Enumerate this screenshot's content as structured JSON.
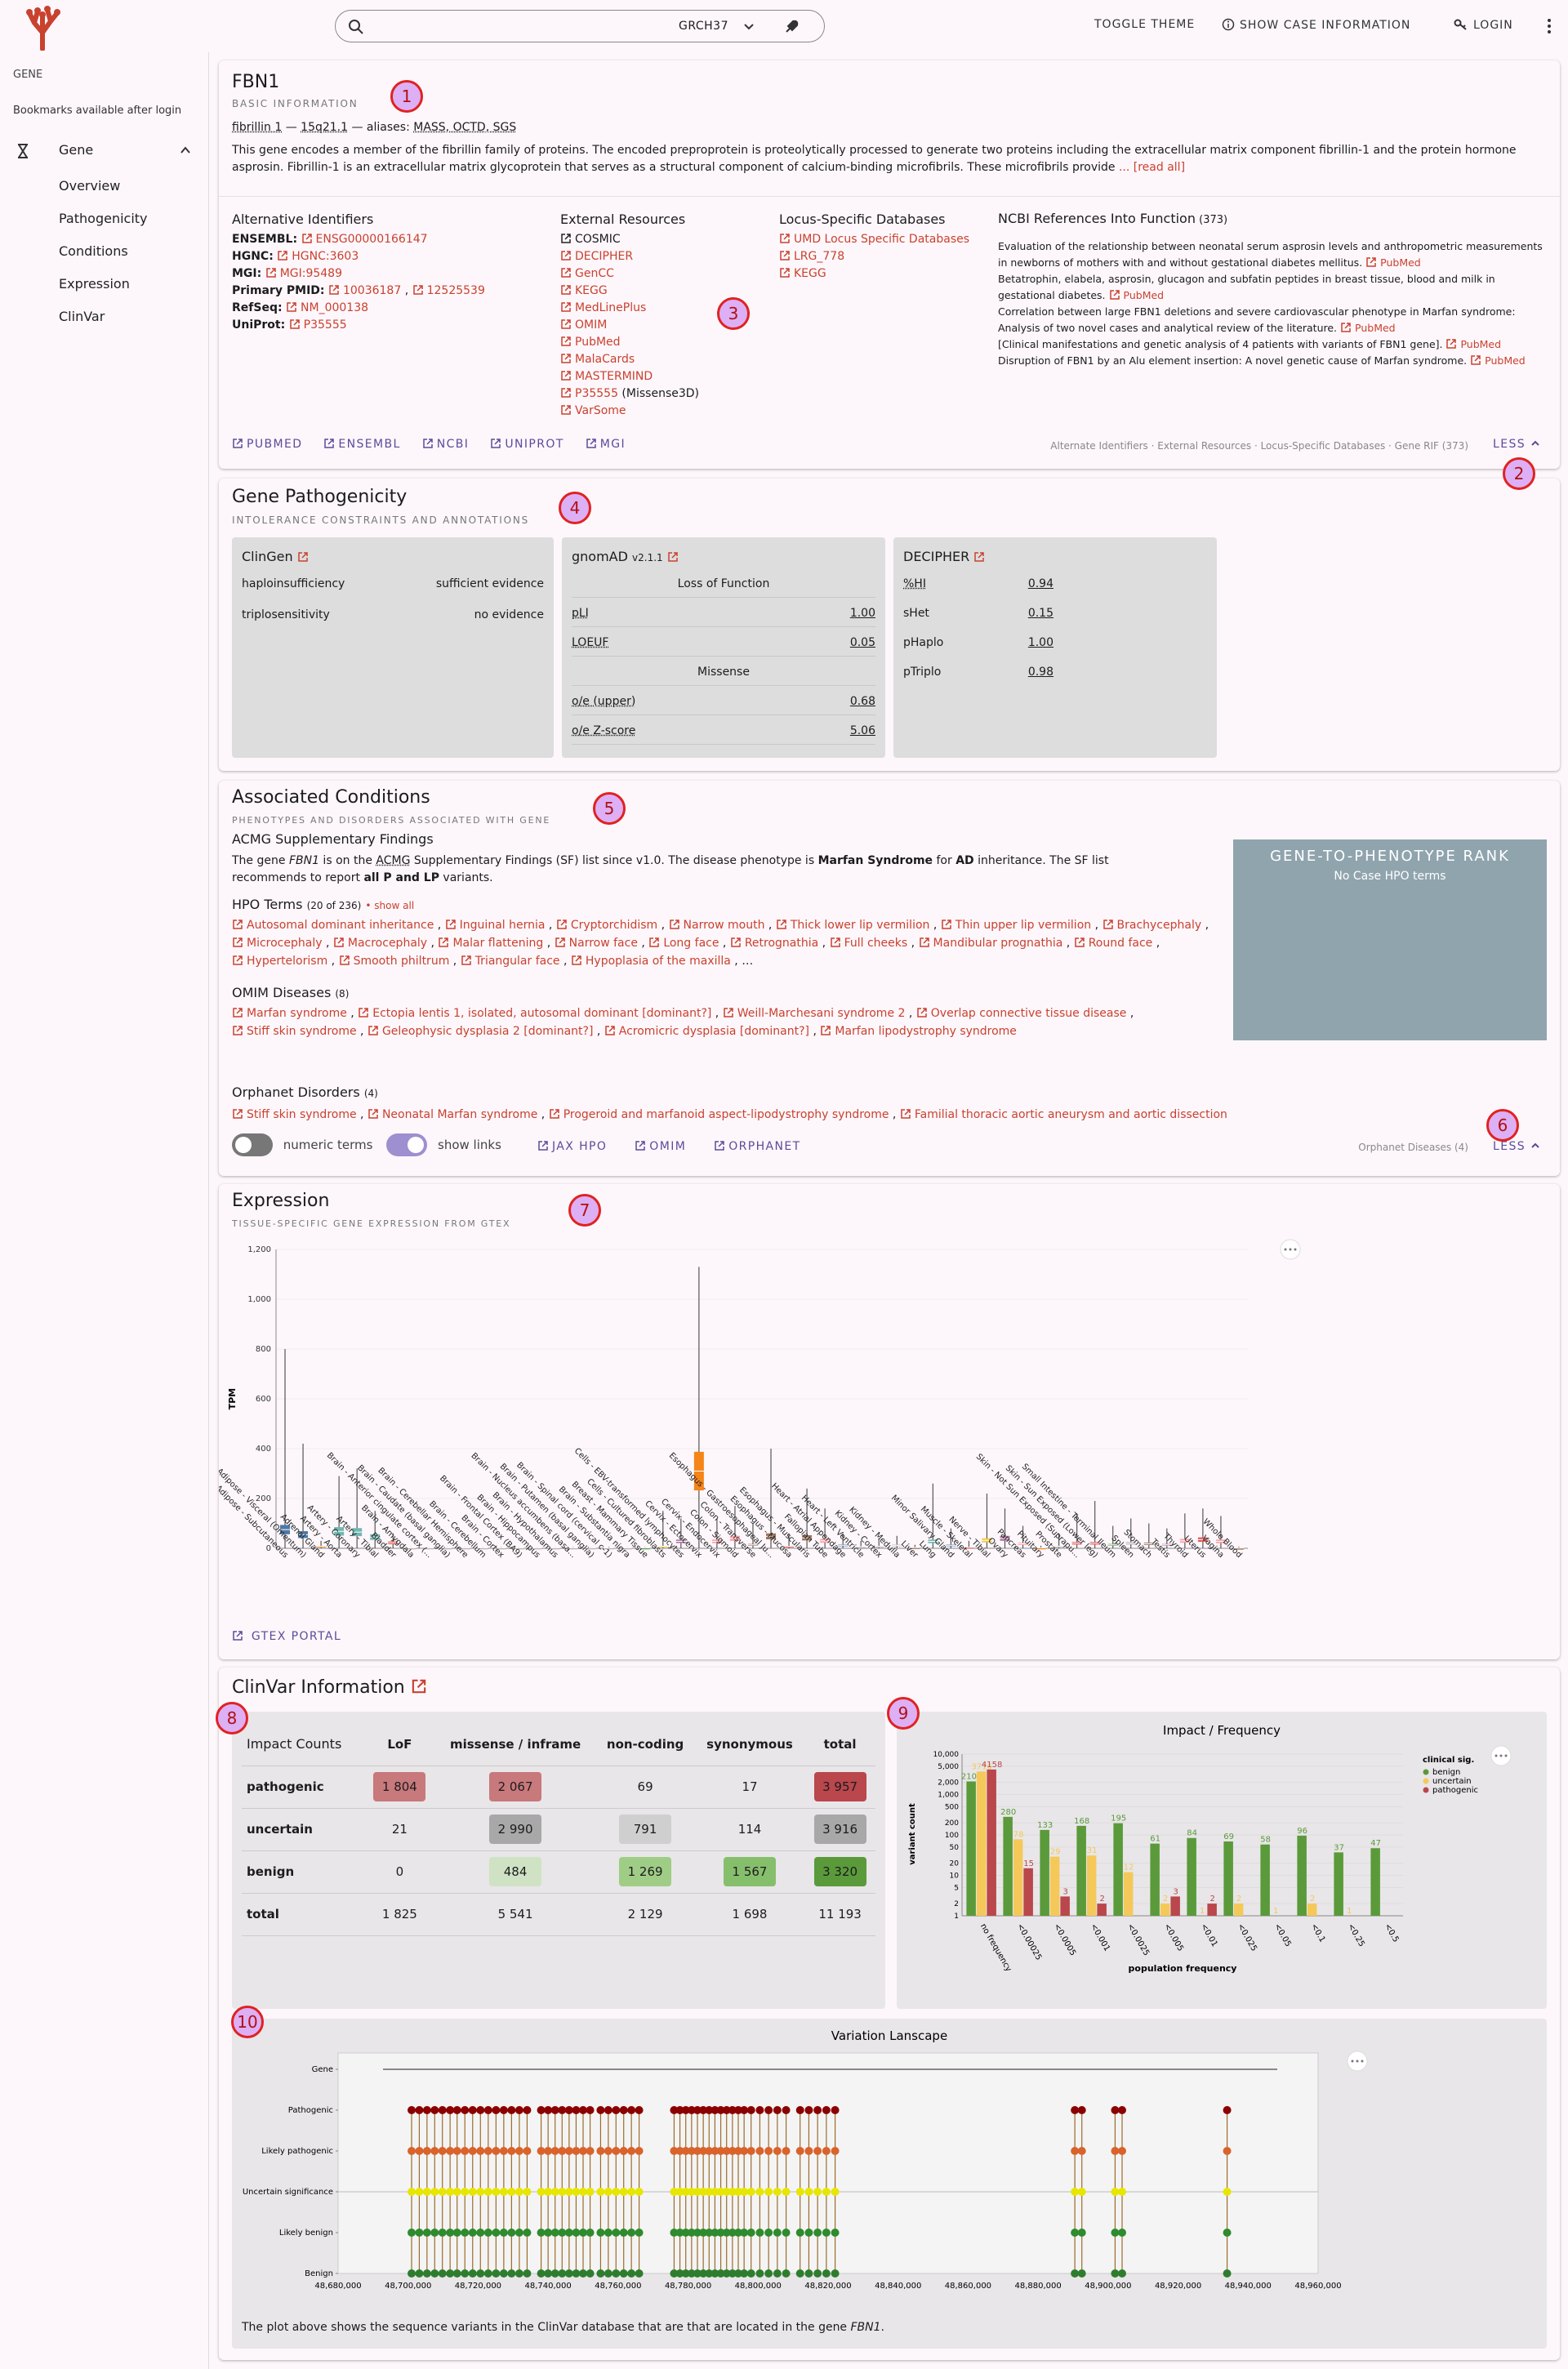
{
  "header": {
    "genome": "GRCH37",
    "toggle_theme": "TOGGLE THEME",
    "show_case": "SHOW CASE INFORMATION",
    "login": "LOGIN"
  },
  "sidebar": {
    "section": "GENE",
    "bookmarks": "Bookmarks available after login",
    "gene": "Gene",
    "items": [
      "Overview",
      "Pathogenicity",
      "Conditions",
      "Expression",
      "ClinVar"
    ]
  },
  "basic": {
    "symbol": "FBN1",
    "subtitle": "BASIC INFORMATION",
    "name": "fibrillin 1",
    "location": "15q21.1",
    "aliases_prefix": " — aliases: ",
    "aliases": "MASS, OCTD, SGS",
    "summary": "This gene encodes a member of the fibrillin family of proteins. The encoded preproprotein is proteolytically processed to generate two proteins including the extracellular matrix component fibrillin-1 and the protein hormone asprosin. Fibrillin-1 is an extracellular matrix glycoprotein that serves as a structural component of calcium-binding microfibrils. These microfibrils provide",
    "read_all": "... [read all]",
    "alt_title": "Alternative Identifiers",
    "alt": [
      {
        "k": "ENSEMBL:",
        "v": "ENSG00000166147"
      },
      {
        "k": "HGNC:",
        "v": "HGNC:3603"
      },
      {
        "k": "MGI:",
        "v": "MGI:95489"
      },
      {
        "k": "RefSeq:",
        "v": "NM_000138"
      },
      {
        "k": "UniProt:",
        "v": "P35555"
      }
    ],
    "pmid_label": "Primary PMID:",
    "pmid1": "10036187",
    "pmid2": "12525539",
    "ext_title": "External Resources",
    "ext_cosmic": "COSMIC",
    "ext": [
      "DECIPHER",
      "GenCC",
      "KEGG",
      "MedLinePlus",
      "OMIM",
      "PubMed",
      "MalaCards",
      "MASTERMIND",
      "P35555"
    ],
    "ext_m3d": " (Missense3D)",
    "ext_last": "VarSome",
    "locus_title": "Locus-Specific Databases",
    "locus": [
      "UMD Locus Specific Databases",
      "LRG_778",
      "KEGG"
    ],
    "rif_title": "NCBI References Into Function",
    "rif_count": " (373)",
    "rif": [
      {
        "t": "Evaluation of the relationship between neonatal serum asprosin levels and anthropometric measurements in newborns of mothers with and without gestational diabetes mellitus.",
        "l": "PubMed"
      },
      {
        "t": "Betatrophin, elabela, asprosin, glucagon and subfatin peptides in breast tissue, blood and milk in gestational diabetes.",
        "l": "PubMed"
      },
      {
        "t": "Correlation between large FBN1 deletions and severe cardiovascular phenotype in Marfan syndrome: Analysis of two novel cases and analytical review of the literature.",
        "l": "PubMed"
      },
      {
        "t": "[Clinical manifestations and genetic analysis of 4 patients with variants of FBN1 gene].",
        "l": "PubMed"
      },
      {
        "t": "Disruption of FBN1 by an Alu element insertion: A novel genetic cause of Marfan syndrome.",
        "l": "PubMed"
      }
    ],
    "links": [
      "PUBMED",
      "ENSEMBL",
      "NCBI",
      "UNIPROT",
      "MGI"
    ],
    "footnote": "Alternate Identifiers · External Resources · Locus-Specific Databases · Gene RIF (373)",
    "less": "LESS"
  },
  "path": {
    "title": "Gene Pathogenicity",
    "subtitle": "INTOLERANCE CONSTRAINTS AND ANNOTATIONS",
    "clingen": {
      "title": "ClinGen",
      "rows": [
        {
          "k": "haploinsufficiency",
          "v": "sufficient evidence"
        },
        {
          "k": "triplosensitivity",
          "v": "no evidence"
        }
      ]
    },
    "gnomad": {
      "title": "gnomAD",
      "ver": "v2.1.1",
      "lof": "Loss of Function",
      "rows1": [
        {
          "k": "pLI",
          "v": "1.00"
        },
        {
          "k": "LOEUF",
          "v": "0.05"
        }
      ],
      "mis": "Missense",
      "rows2": [
        {
          "k": "o/e (upper)",
          "v": "0.68"
        },
        {
          "k": "o/e Z-score",
          "v": "5.06"
        }
      ]
    },
    "decipher": {
      "title": "DECIPHER",
      "rows": [
        {
          "k": "%HI",
          "v": "0.94"
        },
        {
          "k": "sHet",
          "v": "0.15"
        },
        {
          "k": "pHaplo",
          "v": "1.00"
        },
        {
          "k": "pTriplo",
          "v": "0.98"
        }
      ]
    }
  },
  "cond": {
    "title": "Associated Conditions",
    "subtitle": "PHENOTYPES AND DISORDERS ASSOCIATED WITH GENE",
    "acmg_title": "ACMG Supplementary Findings",
    "acmg_1": "The gene ",
    "acmg_gene": "FBN1",
    "acmg_2": " is on the ",
    "acmg_abbr": "ACMG",
    "acmg_3": " Supplementary Findings (SF) list since v1.0. The disease phenotype is ",
    "acmg_dis": "Marfan Syndrome",
    "acmg_4": " for ",
    "acmg_inh": "AD",
    "acmg_5": " inheritance. The SF list recommends to report ",
    "acmg_rep": "all P and LP",
    "acmg_6": " variants.",
    "hpo_title": "HPO Terms",
    "hpo_count": "(20 of 236)",
    "show_all": "• show all",
    "hpo": [
      "Autosomal dominant inheritance",
      "Inguinal hernia",
      "Cryptorchidism",
      "Narrow mouth",
      "Thick lower lip vermilion",
      "Thin upper lip vermilion",
      "Brachycephaly",
      "Microcephaly",
      "Macrocephaly",
      "Malar flattening",
      "Narrow face",
      "Long face",
      "Retrognathia",
      "Full cheeks",
      "Mandibular prognathia",
      "Round face",
      "Hypertelorism",
      "Smooth philtrum",
      "Triangular face",
      "Hypoplasia of the maxilla"
    ],
    "omim_title": "OMIM Diseases",
    "omim_count": "(8)",
    "omim": [
      "Marfan syndrome",
      "Ectopia lentis 1, isolated, autosomal dominant [dominant?]",
      "Weill-Marchesani syndrome 2",
      "Overlap connective tissue disease",
      "Stiff skin syndrome",
      "Geleophysic dysplasia 2 [dominant?]",
      "Acromicric dysplasia [dominant?]",
      "Marfan lipodystrophy syndrome"
    ],
    "orpha_title": "Orphanet Disorders",
    "orpha_count": "(4)",
    "orpha": [
      "Stiff skin syndrome",
      "Neonatal Marfan syndrome",
      "Progeroid and marfanoid aspect-lipodystrophy syndrome",
      "Familial thoracic aortic aneurysm and aortic dissection"
    ],
    "numeric": "numeric terms",
    "showlinks": "show links",
    "links": [
      "JAX HPO",
      "OMIM",
      "ORPHANET"
    ],
    "footnote": "Orphanet Diseases (4)",
    "less": "LESS",
    "g2p_title": "GENE-TO-PHENOTYPE RANK",
    "g2p_text": "No Case HPO terms"
  },
  "expr": {
    "title": "Expression",
    "subtitle": "TISSUE-SPECIFIC GENE EXPRESSION FROM GTEX",
    "ylabel": "TPM",
    "gtex": "GTEX PORTAL"
  },
  "clinvar": {
    "title": "ClinVar Information",
    "table": {
      "corner": "Impact Counts",
      "headers": [
        "LoF",
        "missense / inframe",
        "non-coding",
        "synonymous",
        "total"
      ],
      "rows": [
        {
          "label": "pathogenic",
          "cells": [
            "1 804",
            "2 067",
            "69",
            "17",
            "3 957"
          ]
        },
        {
          "label": "uncertain",
          "cells": [
            "21",
            "2 990",
            "791",
            "114",
            "3 916"
          ]
        },
        {
          "label": "benign",
          "cells": [
            "0",
            "484",
            "1 269",
            "1 567",
            "3 320"
          ]
        },
        {
          "label": "total",
          "cells": [
            "1 825",
            "5 541",
            "2 129",
            "1 698",
            "11 193"
          ]
        }
      ]
    },
    "note": "The plot above shows the sequence variants in the ClinVar database that are that are located in the gene ",
    "note_gene": "FBN1",
    "note_end": "."
  },
  "badges": [
    "1",
    "2",
    "3",
    "4",
    "5",
    "6",
    "7",
    "8",
    "9",
    "10"
  ],
  "colors": {
    "accent": "#c9412f",
    "links": "#5b4b9a",
    "pathogenic": "#b9474b",
    "uncertain": "#f5c85a",
    "benign": "#5a9a3a"
  },
  "chart_data": [
    {
      "type": "box",
      "title": "",
      "ylabel": "TPM",
      "ylim": [
        0,
        1200
      ],
      "yticks": [
        0,
        200,
        400,
        600,
        800,
        1000,
        1200
      ],
      "categories": [
        "Adipose - Subcutaneous",
        "Adipose - Visceral (Omentum)",
        "Adrenal Gland",
        "Artery - Aorta",
        "Artery - Coronary",
        "Artery - Tibial",
        "Bladder",
        "Brain - Amygdala",
        "Brain - Anterior cingulate cortex (...",
        "Brain - Caudate (basal ganglia)",
        "Brain - Cerebellar Hemisphere",
        "Brain - Cerebellum",
        "Brain - Cortex",
        "Brain - Frontal Cortex (BA9)",
        "Brain - Hippocampus",
        "Brain - Hypothalamus",
        "Brain - Nucleus accumbens (basa...",
        "Brain - Putamen (basal ganglia)",
        "Brain - Spinal cord (cervical c-1)",
        "Brain - Substantia nigra",
        "Breast - Mammary Tissue",
        "Cells - Cultured fibroblasts",
        "Cells - EBV-transformed lymphocytes",
        "Cervix - Ectocervix",
        "Cervix - Endocervix",
        "Colon - Sigmoid",
        "Colon - Transverse",
        "Esophagus - Gastroesophageal Ju...",
        "Esophagus - Mucosa",
        "Esophagus - Muscularis",
        "Fallopian Tube",
        "Heart - Atrial Appendage",
        "Heart - Left Ventricle",
        "Kidney - Cortex",
        "Kidney - Medulla",
        "Liver",
        "Lung",
        "Minor Salivary Gland",
        "Muscle - Skeletal",
        "Nerve - Tibial",
        "Ovary",
        "Pancreas",
        "Pituitary",
        "Prostate",
        "Skin - Not Sun Exposed (Suprapu...",
        "Skin - Sun Exposed (Lower leg)",
        "Small Intestine - Terminal Ileum",
        "Spleen",
        "Stomach",
        "Testis",
        "Thyroid",
        "Uterus",
        "Vagina",
        "Whole Blood"
      ],
      "medians": [
        75,
        55,
        8,
        68,
        65,
        45,
        22,
        2,
        2,
        2,
        2,
        2,
        2,
        2,
        2,
        2,
        2,
        2,
        2,
        2,
        2,
        8,
        28,
        310,
        28,
        40,
        14,
        48,
        8,
        42,
        30,
        12,
        6,
        8,
        12,
        3,
        28,
        12,
        4,
        32,
        40,
        18,
        2,
        8,
        20,
        20,
        14,
        20,
        18,
        14,
        30,
        35,
        28,
        1
      ],
      "maxes": [
        800,
        420,
        30,
        290,
        320,
        150,
        60,
        4,
        4,
        4,
        4,
        4,
        5,
        4,
        4,
        4,
        5,
        4,
        6,
        4,
        5,
        150,
        120,
        1130,
        120,
        170,
        100,
        400,
        60,
        240,
        160,
        60,
        30,
        40,
        50,
        14,
        260,
        80,
        30,
        220,
        160,
        90,
        10,
        60,
        140,
        190,
        90,
        120,
        100,
        80,
        140,
        160,
        130,
        6
      ]
    },
    {
      "type": "bar",
      "title": "Impact / Frequency",
      "xlabel": "population frequency",
      "ylabel": "variant count",
      "yscale": "log",
      "ylim": [
        1,
        10000
      ],
      "yticks": [
        "1",
        "2",
        "5",
        "10",
        "20",
        "50",
        "100",
        "200",
        "500",
        "1,000",
        "2,000",
        "5,000",
        "10,000"
      ],
      "categories": [
        "no frequency",
        "<0.00025",
        "<0.0005",
        "<0.001",
        "<0.0025",
        "<0.005",
        "<0.01",
        "<0.025",
        "<0.05",
        "<0.1",
        "<0.25",
        "<0.5"
      ],
      "legend_title": "clinical sig.",
      "series": [
        {
          "name": "benign",
          "values": [
            2106,
            280,
            133,
            168,
            195,
            61,
            84,
            69,
            58,
            96,
            37,
            47
          ]
        },
        {
          "name": "uncertain",
          "values": [
            3716,
            78,
            29,
            31,
            12,
            2,
            1,
            2,
            1,
            2,
            1,
            null
          ]
        },
        {
          "name": "pathogenic",
          "values": [
            4158,
            15,
            3,
            2,
            null,
            3,
            2,
            null,
            null,
            null,
            null,
            null
          ]
        }
      ]
    },
    {
      "type": "scatter",
      "title": "Variation Lanscape",
      "xlim": [
        48680000,
        48960000
      ],
      "xticks": [
        "48,680,000",
        "48,700,000",
        "48,720,000",
        "48,740,000",
        "48,760,000",
        "48,780,000",
        "48,800,000",
        "48,820,000",
        "48,840,000",
        "48,860,000",
        "48,880,000",
        "48,900,000",
        "48,920,000",
        "48,940,000",
        "48,960,000"
      ],
      "categories": [
        "Gene",
        "Pathogenic",
        "Likely pathogenic",
        "Uncertain significance",
        "Likely benign",
        "Benign"
      ]
    }
  ]
}
